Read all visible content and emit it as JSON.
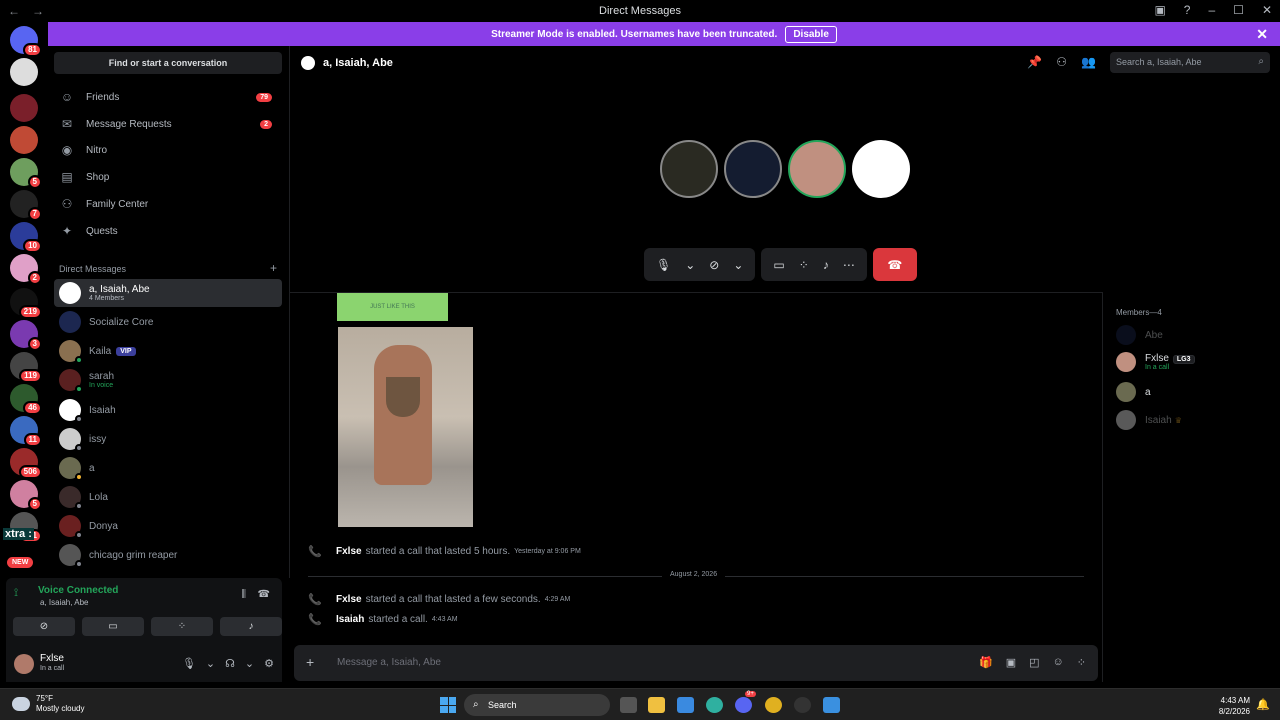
{
  "window": {
    "title": "Direct Messages",
    "back": "←",
    "forward": "→"
  },
  "banner": {
    "text": "Streamer Mode is enabled. Usernames have been truncated.",
    "button": "Disable",
    "accent": "#8a3ee8"
  },
  "servers": {
    "badges": [
      "81",
      "5",
      "7",
      "10",
      "2",
      "219",
      "3",
      "119",
      "46",
      "11",
      "506",
      "5",
      "201"
    ],
    "new_label": "NEW",
    "overlay_text": "xtra :"
  },
  "sidebar": {
    "find_label": "Find or start a conversation",
    "nav": [
      {
        "label": "Friends",
        "count": "79",
        "icon": "friends-icon"
      },
      {
        "label": "Message Requests",
        "count": "2",
        "icon": "mail-icon"
      },
      {
        "label": "Nitro",
        "count": "",
        "icon": "nitro-icon"
      },
      {
        "label": "Shop",
        "count": "",
        "icon": "shop-icon"
      },
      {
        "label": "Family Center",
        "count": "",
        "icon": "family-icon"
      },
      {
        "label": "Quests",
        "count": "",
        "icon": "quests-icon"
      }
    ],
    "dm_header": "Direct Messages",
    "dms": [
      {
        "name": "a, Isaiah, Abe",
        "sub": "4 Members"
      },
      {
        "name": "Socialize Core",
        "sub": ""
      },
      {
        "name": "Kaila",
        "sub": "",
        "tag": "VIP"
      },
      {
        "name": "sarah",
        "sub": "In voice"
      },
      {
        "name": "Isaiah",
        "sub": ""
      },
      {
        "name": "issy",
        "sub": ""
      },
      {
        "name": "a",
        "sub": ""
      },
      {
        "name": "Lola",
        "sub": ""
      },
      {
        "name": "Donya",
        "sub": ""
      },
      {
        "name": "chicago grim reaper",
        "sub": ""
      }
    ]
  },
  "voice": {
    "status": "Voice Connected",
    "channel": "a, Isaiah, Abe"
  },
  "user": {
    "name": "Fxlse",
    "status": "In a call"
  },
  "header": {
    "title": "a, Isaiah, Abe",
    "search_placeholder": "Search a, Isaiah, Abe"
  },
  "chat": {
    "gif_caption": "JUST LIKE THIS",
    "messages": [
      {
        "author": "Fxlse",
        "text": "started a call that lasted 5 hours.",
        "time": "Yesterday at 9:06 PM"
      },
      {
        "author": "Fxlse",
        "text": "started a call that lasted a few seconds.",
        "time": "4:29 AM"
      },
      {
        "author": "Isaiah",
        "text": "started a call.",
        "time": "4:43 AM"
      }
    ],
    "date_divider": "August 2, 2026",
    "composer_placeholder": "Message a, Isaiah, Abe"
  },
  "members": {
    "header": "Members—4",
    "list": [
      {
        "name": "Abe",
        "sub": "",
        "tag": ""
      },
      {
        "name": "Fxlse",
        "sub": "In a call",
        "tag": "LG3"
      },
      {
        "name": "a",
        "sub": "",
        "tag": ""
      },
      {
        "name": "Isaiah",
        "sub": "",
        "tag": "♛"
      }
    ]
  },
  "taskbar": {
    "temp": "75°F",
    "weather": "Mostly cloudy",
    "search": "Search",
    "time": "4:43 AM",
    "date": "8/2/2026",
    "discord_badge": "9+"
  }
}
